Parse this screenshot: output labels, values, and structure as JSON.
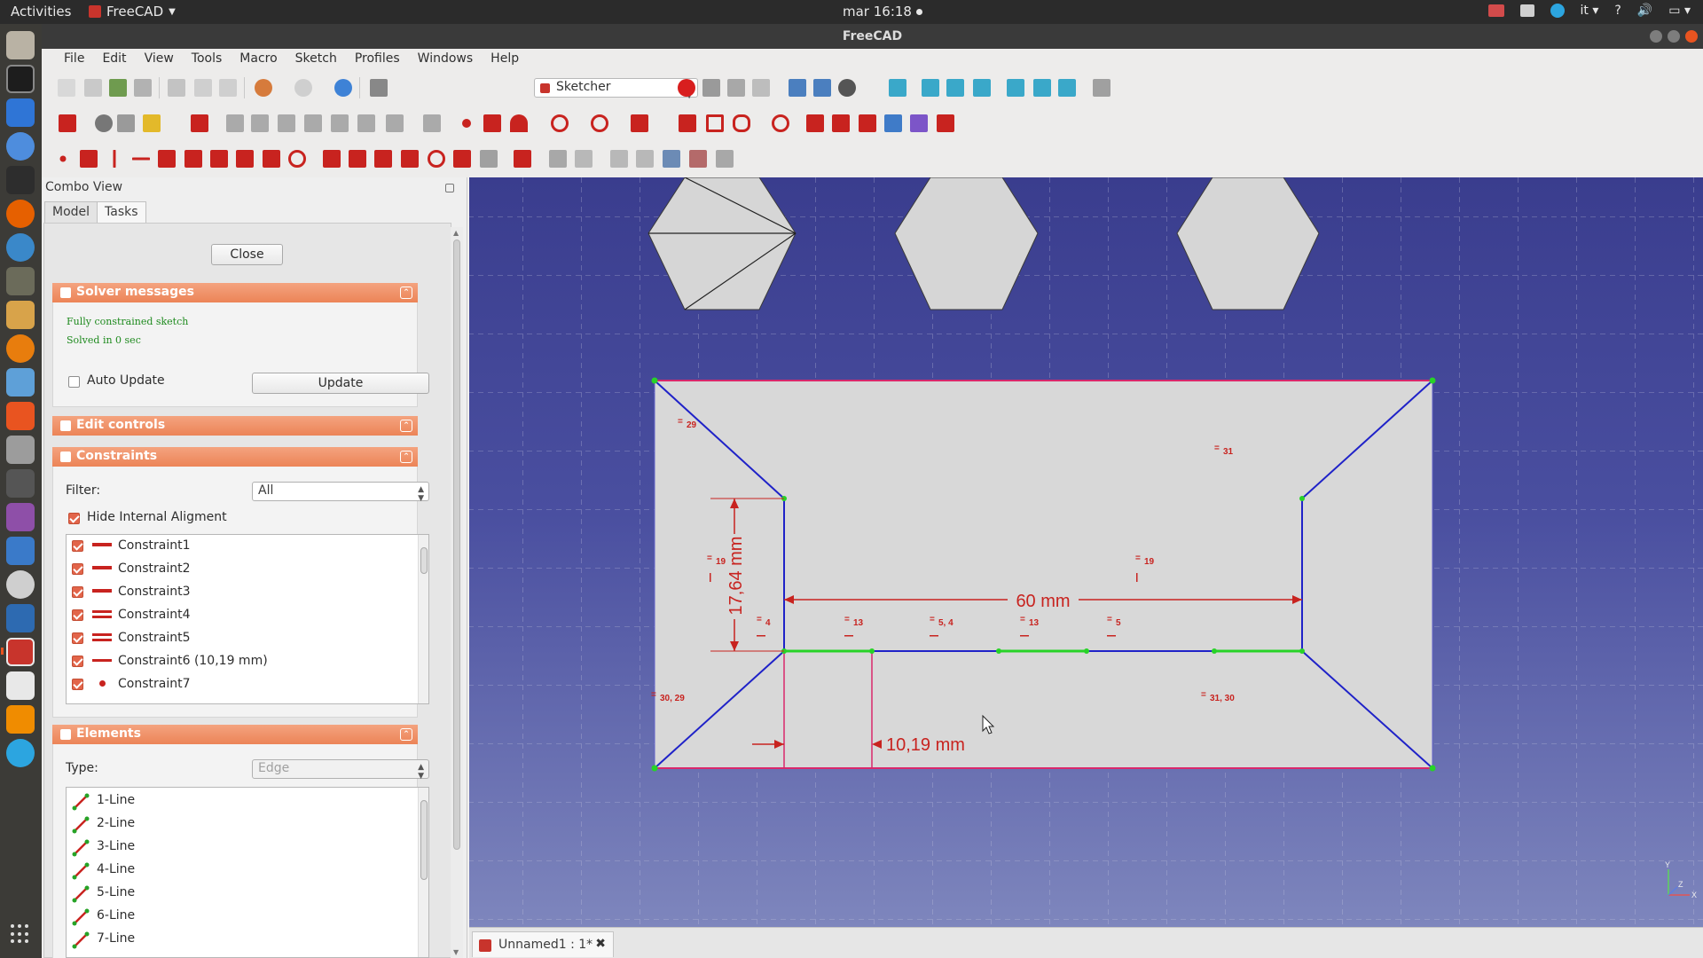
{
  "topbar": {
    "activities": "Activities",
    "app_name": "FreeCAD",
    "clock": "mar 16:18",
    "lang": "it",
    "help": "?"
  },
  "window": {
    "title": "FreeCAD"
  },
  "menu": [
    "File",
    "Edit",
    "View",
    "Tools",
    "Macro",
    "Sketch",
    "Profiles",
    "Windows",
    "Help"
  ],
  "toolbar": {
    "workbench": "Sketcher"
  },
  "combo_view": {
    "title": "Combo View",
    "tabs": [
      "Model",
      "Tasks"
    ],
    "active_tab": "Tasks",
    "close_label": "Close",
    "solver": {
      "header": "Solver messages",
      "status": "Fully constrained sketch",
      "time": "Solved in 0 sec",
      "auto_update_label": "Auto Update",
      "update_label": "Update"
    },
    "edit_controls": {
      "header": "Edit controls"
    },
    "constraints": {
      "header": "Constraints",
      "filter_label": "Filter:",
      "filter_value": "All",
      "hide_internal_label": "Hide Internal Aligment",
      "items": [
        {
          "label": "Constraint1",
          "icon": "horizontal-constraint-icon"
        },
        {
          "label": "Constraint2",
          "icon": "horizontal-constraint-icon"
        },
        {
          "label": "Constraint3",
          "icon": "horizontal-constraint-icon"
        },
        {
          "label": "Constraint4",
          "icon": "equal-constraint-icon"
        },
        {
          "label": "Constraint5",
          "icon": "equal-constraint-icon"
        },
        {
          "label": "Constraint6 (10,19 mm)",
          "icon": "horizontal-distance-icon"
        },
        {
          "label": "Constraint7",
          "icon": "coincident-constraint-icon"
        }
      ]
    },
    "elements": {
      "header": "Elements",
      "type_label": "Type:",
      "type_value": "Edge",
      "items": [
        "1-Line",
        "2-Line",
        "3-Line",
        "4-Line",
        "5-Line",
        "6-Line",
        "7-Line"
      ]
    }
  },
  "sketch": {
    "dim_60": "60 mm",
    "dim_1764": "17,64 mm",
    "dim_1019": "10,19 mm",
    "labels": {
      "c29": "29",
      "c31": "31",
      "c19a": "19",
      "c19b": "19",
      "c4": "4",
      "c13a": "13",
      "c54": "5, 4",
      "c13b": "13",
      "c5": "5",
      "c3029": "30, 29",
      "c3130": "31, 30"
    },
    "axes": {
      "x": "X",
      "y": "Y",
      "z": "Z"
    }
  },
  "doc_tab": {
    "label": "Unnamed1 : 1*"
  },
  "colors": {
    "accent": "#ec8457",
    "constraint_red": "#c8231f",
    "sketch_blue": "#1f22c8",
    "sketch_green": "#27d327"
  }
}
